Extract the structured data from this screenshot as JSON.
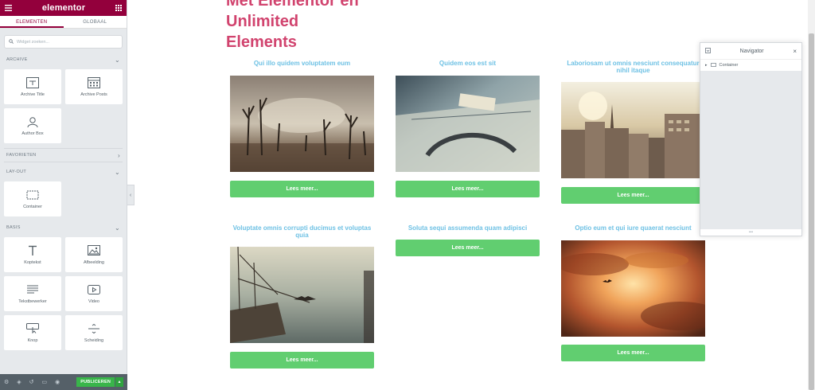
{
  "sidebar": {
    "brand": "elementor",
    "tabs": [
      "ELEMENTEN",
      "GLOBAAL"
    ],
    "search_placeholder": "Widget zoeken...",
    "sections": {
      "archive": "ARCHIVE",
      "favorieten": "FAVORIETEN",
      "layout": "LAY-OUT",
      "basis": "BASIS"
    },
    "widgets": {
      "archive_title": "Archive Title",
      "archive_posts": "Archive Posts",
      "author_box": "Author Box",
      "container": "Container",
      "kopteskt": "Koptekst",
      "afbeelding": "Afbeelding",
      "teksteditor": "Tekstbewerker",
      "video": "Video",
      "knop": "Knop",
      "scheiding": "Scheiding"
    },
    "publish_label": "PUBLICEREN"
  },
  "page": {
    "heading_line1": "Met Elementor en",
    "heading_line2": "Unlimited",
    "heading_line3": "Elements",
    "cards": [
      {
        "title": "Qui illo quidem voluptatem eum",
        "button": "Lees meer..."
      },
      {
        "title": "Quidem eos est sit",
        "button": "Lees meer..."
      },
      {
        "title": "Laboriosam ut omnis nesciunt consequatur nihil itaque",
        "button": "Lees meer..."
      },
      {
        "title": "Voluptate omnis corrupti ducimus et voluptas quia",
        "button": "Lees meer..."
      },
      {
        "title": "Soluta sequi assumenda quam adipisci",
        "button": "Lees meer..."
      },
      {
        "title": "Optio eum et qui iure quaerat nesciunt",
        "button": "Lees meer..."
      }
    ]
  },
  "navigator": {
    "title": "Navigator",
    "item": "Container"
  },
  "colors": {
    "brand": "#93003c",
    "heading": "#d1436e",
    "card_title": "#6ec1e4",
    "button": "#61ce70",
    "publish": "#39b54a"
  }
}
